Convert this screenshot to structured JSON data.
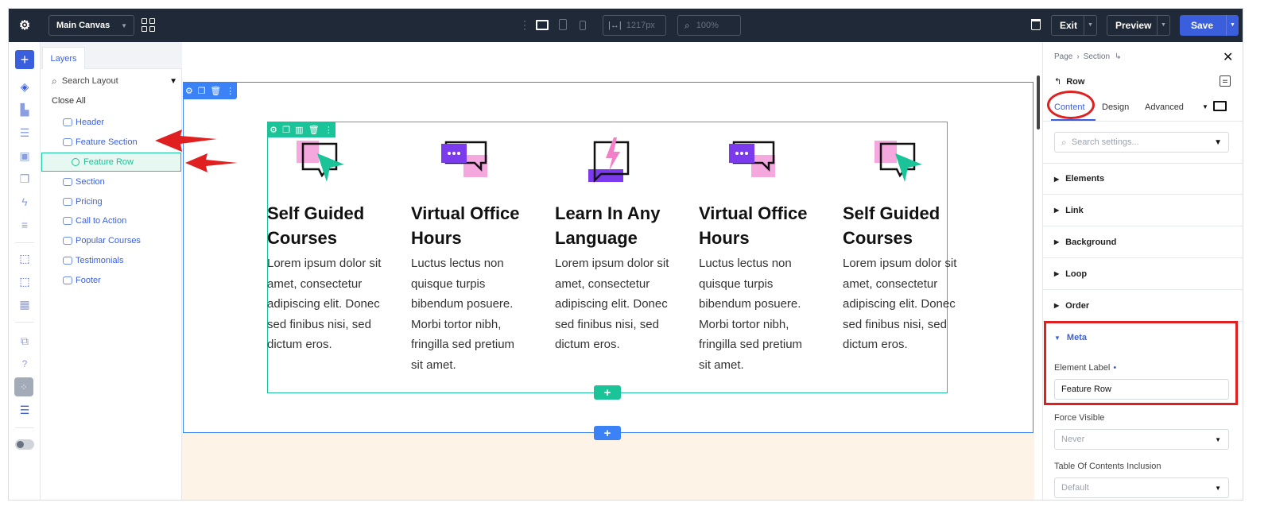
{
  "topbar": {
    "canvas_select": "Main Canvas",
    "width_value": "1217px",
    "zoom_value": "100%",
    "exit_label": "Exit",
    "preview_label": "Preview",
    "save_label": "Save"
  },
  "layers": {
    "tab_label": "Layers",
    "search_placeholder": "Search Layout",
    "close_all_label": "Close All",
    "items": [
      {
        "label": "Header"
      },
      {
        "label": "Feature Section"
      },
      {
        "label": "Feature Row"
      },
      {
        "label": "Section"
      },
      {
        "label": "Pricing"
      },
      {
        "label": "Call to Action"
      },
      {
        "label": "Popular Courses"
      },
      {
        "label": "Testimonials"
      },
      {
        "label": "Footer"
      }
    ]
  },
  "canvas": {
    "columns": [
      {
        "title_line1": "Self Guided",
        "title_line2": "Courses",
        "body": [
          "Lorem ipsum dolor sit",
          "amet, consectetur",
          "adipiscing elit. Donec",
          "sed finibus nisi, sed",
          "dictum eros."
        ],
        "icon": "chat-cursor-icon"
      },
      {
        "title_line1": "Virtual Office",
        "title_line2": "Hours",
        "body": [
          "Luctus lectus non",
          "quisque turpis",
          "bibendum posuere.",
          "Morbi tortor nibh,",
          "fringilla sed pretium",
          "sit amet."
        ],
        "icon": "chat-bubbles-icon"
      },
      {
        "title_line1": "Learn In Any",
        "title_line2": "Language",
        "body": [
          "Lorem ipsum dolor sit",
          "amet, consectetur",
          "adipiscing elit. Donec",
          "sed finibus nisi, sed",
          "dictum eros."
        ],
        "icon": "lightning-chat-icon"
      },
      {
        "title_line1": "Virtual Office",
        "title_line2": "Hours",
        "body": [
          "Luctus lectus non",
          "quisque turpis",
          "bibendum posuere.",
          "Morbi tortor nibh,",
          "fringilla sed pretium",
          "sit amet."
        ],
        "icon": "chat-bubbles-icon"
      },
      {
        "title_line1": "Self Guided",
        "title_line2": "Courses",
        "body": [
          "Lorem ipsum dolor sit",
          "amet, consectetur",
          "adipiscing elit. Donec",
          "sed finibus nisi, sed",
          "dictum eros."
        ],
        "icon": "chat-cursor-icon"
      }
    ]
  },
  "settings": {
    "breadcrumb_page": "Page",
    "breadcrumb_section": "Section",
    "element_name": "Row",
    "tabs": [
      "Content",
      "Design",
      "Advanced"
    ],
    "search_placeholder": "Search settings...",
    "sections": [
      "Elements",
      "Link",
      "Background",
      "Loop",
      "Order",
      "Meta"
    ],
    "element_label_title": "Element Label",
    "element_label_value": "Feature Row",
    "force_visible_title": "Force Visible",
    "force_visible_value": "Never",
    "toc_title": "Table Of Contents Inclusion",
    "toc_value": "Default"
  },
  "colors": {
    "topbar_bg": "#1f2937",
    "accent_blue": "#3b5fdc",
    "row_green": "#1bc498",
    "section_blue": "#3b82f6",
    "annotation_red": "#e02020",
    "save_button": "#3b5fdc"
  }
}
